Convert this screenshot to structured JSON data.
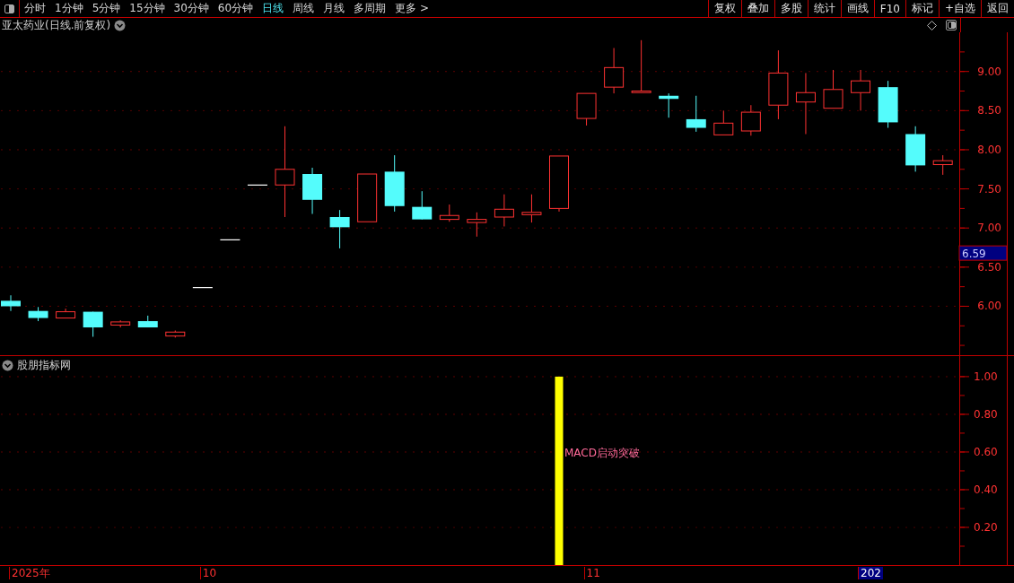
{
  "toolbar": {
    "periods": [
      {
        "label": "分时",
        "selected": false
      },
      {
        "label": "1分钟",
        "selected": false
      },
      {
        "label": "5分钟",
        "selected": false
      },
      {
        "label": "15分钟",
        "selected": false
      },
      {
        "label": "30分钟",
        "selected": false
      },
      {
        "label": "60分钟",
        "selected": false
      },
      {
        "label": "日线",
        "selected": true
      },
      {
        "label": "周线",
        "selected": false
      },
      {
        "label": "月线",
        "selected": false
      },
      {
        "label": "多周期",
        "selected": false
      },
      {
        "label": "更多 >",
        "selected": false
      }
    ],
    "buttons": [
      "复权",
      "叠加",
      "多股",
      "统计",
      "画线",
      "F10",
      "标记",
      "+自选",
      "返回"
    ]
  },
  "main_chart": {
    "title": "亚太药业(日线.前复权)",
    "cursor_price": "6.59",
    "price_axis": [
      "9.00",
      "8.50",
      "8.00",
      "7.50",
      "7.00",
      "6.50",
      "6.00"
    ]
  },
  "indicator": {
    "title": "股朋指标网",
    "value_axis": [
      "1.00",
      "0.80",
      "0.60",
      "0.40",
      "0.20"
    ],
    "signal_label": "MACD启动突破"
  },
  "x_axis": {
    "labels": [
      {
        "text": "2025年",
        "highlight": false
      },
      {
        "text": "10",
        "highlight": false
      },
      {
        "text": "11",
        "highlight": false
      },
      {
        "text": "202",
        "highlight": true
      }
    ]
  }
}
